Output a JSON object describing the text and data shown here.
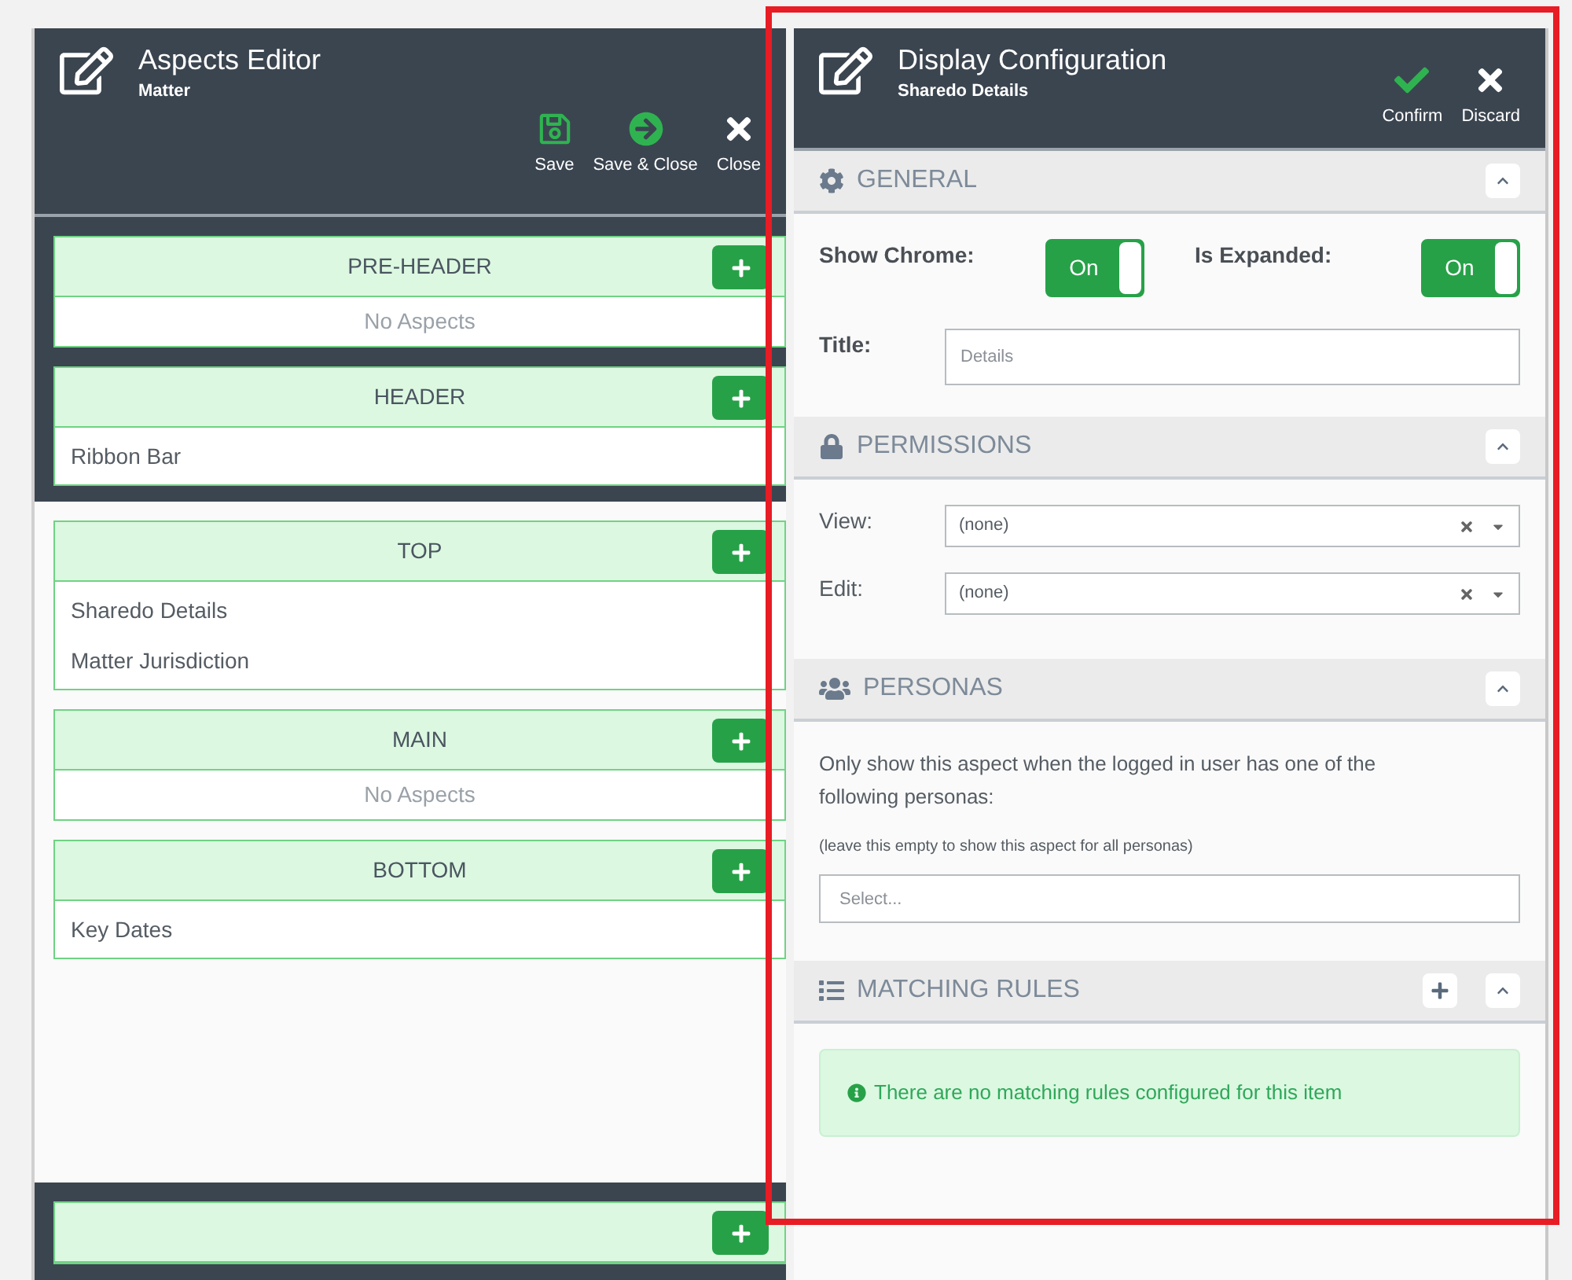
{
  "aspects_editor": {
    "title": "Aspects Editor",
    "subtitle": "Matter",
    "actions": [
      {
        "kind": "save",
        "label": "Save"
      },
      {
        "kind": "save_close",
        "label": "Save & Close"
      },
      {
        "kind": "close",
        "label": "Close"
      }
    ],
    "zones": [
      {
        "kind": "dark",
        "sections": [
          {
            "title": "PRE-HEADER",
            "empty_text": "No Aspects"
          },
          {
            "title": "HEADER",
            "items": [
              "Ribbon Bar"
            ]
          }
        ]
      },
      {
        "kind": "light",
        "sections": [
          {
            "title": "TOP",
            "items": [
              "Sharedo Details",
              "Matter Jurisdiction"
            ]
          },
          {
            "title": "MAIN",
            "empty_text": "No Aspects"
          },
          {
            "title": "BOTTOM",
            "items": [
              "Key Dates"
            ]
          }
        ]
      },
      {
        "kind": "dark",
        "sections": [
          {
            "kind": "cut_off"
          }
        ]
      }
    ]
  },
  "display_configuration": {
    "title": "Display Configuration",
    "subtitle": "Sharedo Details",
    "actions": [
      {
        "kind": "confirm",
        "label": "Confirm"
      },
      {
        "kind": "discard",
        "label": "Discard"
      }
    ],
    "sections": [
      {
        "kind": "general",
        "title": "GENERAL",
        "expanded": true,
        "toggles": [
          {
            "label": "Show Chrome:",
            "on": true,
            "text": "On"
          },
          {
            "label": "Is Expanded:",
            "on": true,
            "text": "On"
          }
        ],
        "title_field": {
          "label": "Title:",
          "placeholder": "Details"
        }
      },
      {
        "kind": "permissions",
        "title": "PERMISSIONS",
        "expanded": true,
        "selects": [
          {
            "label": "View:",
            "value": "(none)"
          },
          {
            "label": "Edit:",
            "value": "(none)"
          }
        ]
      },
      {
        "kind": "personas",
        "title": "PERSONAS",
        "expanded": true,
        "description": "Only show this aspect when the logged in user has one of the following personas:",
        "hint": "(leave this empty to show this aspect for all personas)",
        "select": {
          "placeholder": "Select..."
        }
      },
      {
        "kind": "matching_rules",
        "title": "MATCHING RULES",
        "expanded": true,
        "message": "There are no matching rules configured for this item"
      }
    ]
  }
}
